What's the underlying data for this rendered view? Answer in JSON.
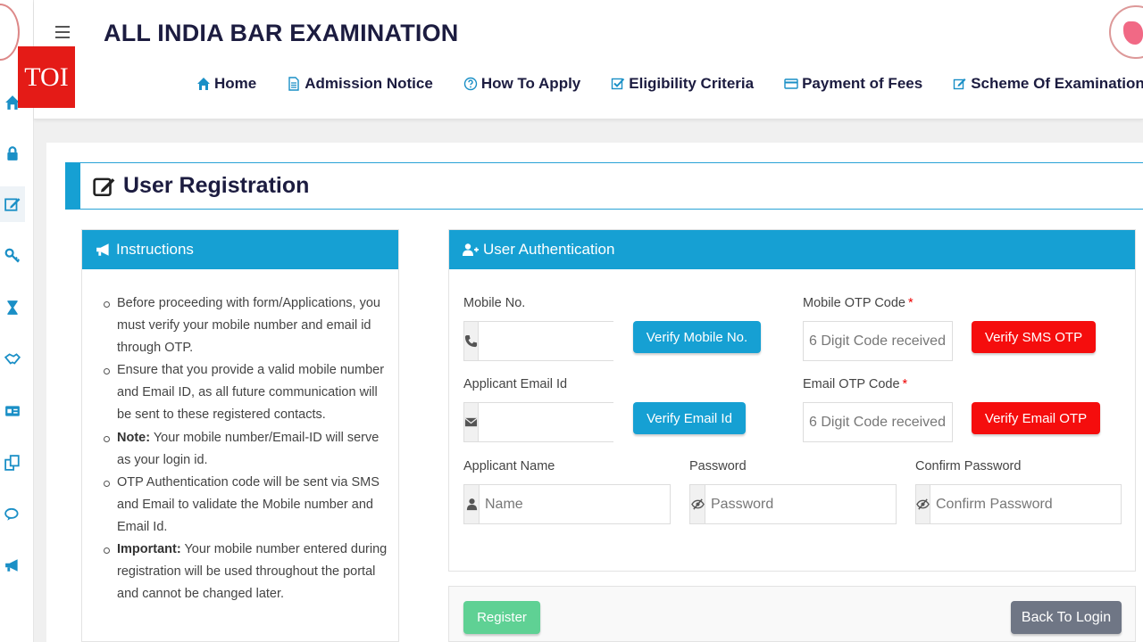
{
  "header": {
    "title": "ALL INDIA BAR EXAMINATION",
    "badge": "TOI"
  },
  "nav": [
    {
      "label": "Home",
      "icon": "home-icon"
    },
    {
      "label": "Admission Notice",
      "icon": "document-icon"
    },
    {
      "label": "How To Apply",
      "icon": "question-circle-icon"
    },
    {
      "label": "Eligibility Criteria",
      "icon": "check-square-icon"
    },
    {
      "label": "Payment of Fees",
      "icon": "credit-card-icon"
    },
    {
      "label": "Scheme Of Examination",
      "icon": "edit-square-icon"
    }
  ],
  "sidebar": {
    "icons": [
      "home-icon",
      "lock-icon",
      "edit-icon",
      "key-icon",
      "hourglass-icon",
      "handshake-icon",
      "id-card-icon",
      "copy-icon",
      "comments-icon",
      "bullhorn-icon"
    ]
  },
  "page": {
    "heading": "User Registration"
  },
  "instructions": {
    "title": "Instructions",
    "items": [
      {
        "bold": "",
        "text": "Before proceeding with form/Applications, you must verify your mobile number and email id through OTP."
      },
      {
        "bold": "",
        "text": "Ensure that you provide a valid mobile number and Email ID, as all future communication will be sent to these registered contacts."
      },
      {
        "bold": "Note:",
        "text": " Your mobile number/Email-ID will serve as your login id."
      },
      {
        "bold": "",
        "text": "OTP Authentication code will be sent via SMS and Email to validate the Mobile number and Email Id."
      },
      {
        "bold": "Important:",
        "text": " Your mobile number entered during registration will be used throughout the portal and cannot be changed later."
      }
    ]
  },
  "auth": {
    "title": "User Authentication",
    "mobile_label": "Mobile No.",
    "mobile_value": "",
    "verify_mobile": "Verify Mobile No.",
    "mobile_otp_label": "Mobile OTP Code",
    "required_mark": "*",
    "otp_placeholder": "6 Digit Code received",
    "verify_sms": "Verify SMS OTP",
    "email_label": "Applicant Email Id",
    "email_value": "",
    "verify_email": "Verify Email Id",
    "email_otp_label": "Email OTP Code",
    "verify_email_otp": "Verify Email OTP",
    "name_label": "Applicant Name",
    "name_placeholder": "Name",
    "password_label": "Password",
    "password_placeholder": "Password",
    "confirm_label": "Confirm Password",
    "confirm_placeholder": "Confirm Password"
  },
  "actions": {
    "register": "Register",
    "back": "Back To Login"
  },
  "colors": {
    "accent": "#16a0d3",
    "danger": "#f50d0d",
    "success": "#5fd194",
    "secondary": "#6f7685"
  }
}
